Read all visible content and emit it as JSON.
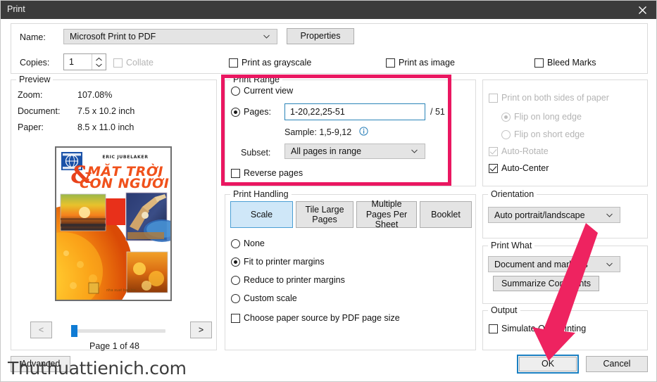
{
  "window": {
    "title": "Print",
    "close_icon": "close-icon"
  },
  "printer": {
    "name_label": "Name:",
    "name_value": "Microsoft Print to PDF",
    "properties_label": "Properties",
    "copies_label": "Copies:",
    "copies_value": "1",
    "collate_label": "Collate",
    "grayscale_label": "Print as grayscale",
    "image_label": "Print as image",
    "bleed_label": "Bleed Marks"
  },
  "preview": {
    "group_title": "Preview",
    "zoom_label": "Zoom:",
    "zoom_value": "107.08%",
    "document_label": "Document:",
    "document_value": "7.5 x 10.2 inch",
    "paper_label": "Paper:",
    "paper_value": "8.5 x 11.0 inch",
    "prev_label": "<",
    "next_label": ">",
    "page_status": "Page 1 of 48",
    "cover": {
      "author": "ERIC JUBELAKER",
      "title_line1": "MẶT TRỜI",
      "title_line2": "CON NGƯỜI",
      "ampersand": "&",
      "publisher": "nha xuat ban tre"
    }
  },
  "print_range": {
    "group_title": "Print Range",
    "current_view_label": "Current view",
    "pages_label": "Pages:",
    "pages_value": "1-20,22,25-51",
    "total_pages": "/ 51",
    "sample_label": "Sample: 1,5-9,12",
    "info_icon": "info-icon",
    "subset_label": "Subset:",
    "subset_value": "All pages in range",
    "reverse_label": "Reverse pages"
  },
  "print_handling": {
    "group_title": "Print Handling",
    "tabs": [
      {
        "label": "Scale",
        "selected": true
      },
      {
        "label": "Tile Large Pages",
        "selected": false
      },
      {
        "label": "Multiple Pages Per Sheet",
        "selected": false
      },
      {
        "label": "Booklet",
        "selected": false
      }
    ],
    "options": [
      {
        "label": "None",
        "selected": false
      },
      {
        "label": "Fit to printer margins",
        "selected": true
      },
      {
        "label": "Reduce to printer margins",
        "selected": false
      },
      {
        "label": "Custom scale",
        "selected": false
      }
    ],
    "paper_source_label": "Choose paper source by PDF page size"
  },
  "duplex": {
    "both_sides_label": "Print on both sides of paper",
    "flip_long_label": "Flip on long edge",
    "flip_short_label": "Flip on short edge",
    "auto_rotate_label": "Auto-Rotate",
    "auto_center_label": "Auto-Center"
  },
  "orientation": {
    "group_title": "Orientation",
    "value": "Auto portrait/landscape"
  },
  "print_what": {
    "group_title": "Print What",
    "value": "Document and markups",
    "summarize_label": "Summarize Comments"
  },
  "output": {
    "group_title": "Output",
    "simulate_label": "Simulate Overprinting"
  },
  "footer": {
    "advanced_label": "Advanced",
    "ok_label": "OK",
    "cancel_label": "Cancel"
  },
  "watermark": "Thuthuattienich.com",
  "annotation": {
    "highlight_color": "#ea1761",
    "arrow_color": "#ee2360"
  }
}
